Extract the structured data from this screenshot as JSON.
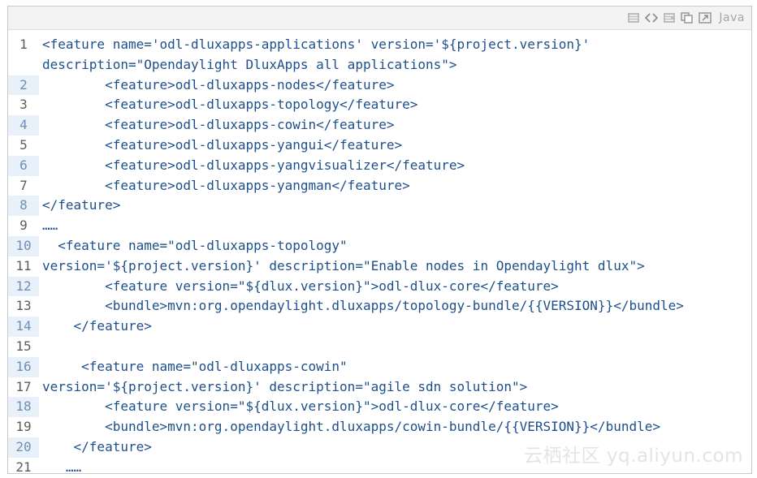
{
  "toolbar": {
    "language": "Java",
    "icons": [
      "view-source-icon",
      "code-tags-icon",
      "wrap-lines-icon",
      "copy-icon",
      "popup-icon"
    ]
  },
  "code": {
    "lines": [
      {
        "num": "1",
        "text": "<feature name='odl-dluxapps-applications' version='${project.version}'"
      },
      {
        "num": "",
        "text": "description=\"Opendaylight DluxApps all applications\">"
      },
      {
        "num": "2",
        "text": "        <feature>odl-dluxapps-nodes</feature>"
      },
      {
        "num": "3",
        "text": "        <feature>odl-dluxapps-topology</feature>"
      },
      {
        "num": "4",
        "text": "        <feature>odl-dluxapps-cowin</feature>"
      },
      {
        "num": "5",
        "text": "        <feature>odl-dluxapps-yangui</feature>"
      },
      {
        "num": "6",
        "text": "        <feature>odl-dluxapps-yangvisualizer</feature>"
      },
      {
        "num": "7",
        "text": "        <feature>odl-dluxapps-yangman</feature>"
      },
      {
        "num": "8",
        "text": "</feature>"
      },
      {
        "num": "9",
        "text": "……"
      },
      {
        "num": "10",
        "text": "  <feature name=\"odl-dluxapps-topology\""
      },
      {
        "num": "11",
        "text": "version='${project.version}' description=\"Enable nodes in Opendaylight dlux\">"
      },
      {
        "num": "12",
        "text": "        <feature version=\"${dlux.version}\">odl-dlux-core</feature>"
      },
      {
        "num": "13",
        "text": "        <bundle>mvn:org.opendaylight.dluxapps/topology-bundle/{{VERSION}}</bundle>"
      },
      {
        "num": "14",
        "text": "    </feature>"
      },
      {
        "num": "15",
        "text": ""
      },
      {
        "num": "16",
        "text": "     <feature name=\"odl-dluxapps-cowin\""
      },
      {
        "num": "17",
        "text": "version='${project.version}' description=\"agile sdn solution\">"
      },
      {
        "num": "18",
        "text": "        <feature version=\"${dlux.version}\">odl-dlux-core</feature>"
      },
      {
        "num": "19",
        "text": "        <bundle>mvn:org.opendaylight.dluxapps/cowin-bundle/{{VERSION}}</bundle>"
      },
      {
        "num": "20",
        "text": "    </feature>"
      },
      {
        "num": "21",
        "text": "   ……"
      }
    ]
  },
  "watermark": "云栖社区 yq.aliyun.com"
}
